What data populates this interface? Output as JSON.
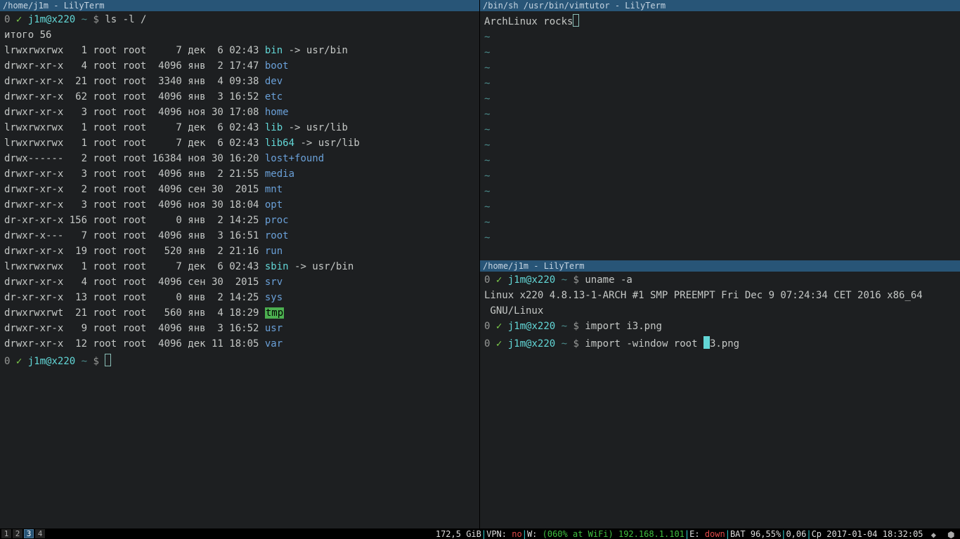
{
  "left": {
    "title": "/home/j1m - LilyTerm",
    "prompt_exit": "0",
    "prompt_check": "✓",
    "prompt_user": "j1m@x220",
    "prompt_tilde": "~",
    "prompt_dollar": "$",
    "cmd1": "ls -l /",
    "total": "итого 56",
    "rows": [
      {
        "perm": "lrwxrwxrwx",
        "n": "  1",
        "og": "root root",
        "sz": "    7",
        "date": "дек  6 02:43",
        "name": "bin",
        "link": " -> usr/bin"
      },
      {
        "perm": "drwxr-xr-x",
        "n": "  4",
        "og": "root root",
        "sz": " 4096",
        "date": "янв  2 17:47",
        "name": "boot",
        "link": ""
      },
      {
        "perm": "drwxr-xr-x",
        "n": " 21",
        "og": "root root",
        "sz": " 3340",
        "date": "янв  4 09:38",
        "name": "dev",
        "link": ""
      },
      {
        "perm": "drwxr-xr-x",
        "n": " 62",
        "og": "root root",
        "sz": " 4096",
        "date": "янв  3 16:52",
        "name": "etc",
        "link": ""
      },
      {
        "perm": "drwxr-xr-x",
        "n": "  3",
        "og": "root root",
        "sz": " 4096",
        "date": "ноя 30 17:08",
        "name": "home",
        "link": ""
      },
      {
        "perm": "lrwxrwxrwx",
        "n": "  1",
        "og": "root root",
        "sz": "    7",
        "date": "дек  6 02:43",
        "name": "lib",
        "link": " -> usr/lib"
      },
      {
        "perm": "lrwxrwxrwx",
        "n": "  1",
        "og": "root root",
        "sz": "    7",
        "date": "дек  6 02:43",
        "name": "lib64",
        "link": " -> usr/lib"
      },
      {
        "perm": "drwx------",
        "n": "  2",
        "og": "root root",
        "sz": "16384",
        "date": "ноя 30 16:20",
        "name": "lost+found",
        "link": ""
      },
      {
        "perm": "drwxr-xr-x",
        "n": "  3",
        "og": "root root",
        "sz": " 4096",
        "date": "янв  2 21:55",
        "name": "media",
        "link": ""
      },
      {
        "perm": "drwxr-xr-x",
        "n": "  2",
        "og": "root root",
        "sz": " 4096",
        "date": "сен 30  2015",
        "name": "mnt",
        "link": ""
      },
      {
        "perm": "drwxr-xr-x",
        "n": "  3",
        "og": "root root",
        "sz": " 4096",
        "date": "ноя 30 18:04",
        "name": "opt",
        "link": ""
      },
      {
        "perm": "dr-xr-xr-x",
        "n": "156",
        "og": "root root",
        "sz": "    0",
        "date": "янв  2 14:25",
        "name": "proc",
        "link": ""
      },
      {
        "perm": "drwxr-x---",
        "n": "  7",
        "og": "root root",
        "sz": " 4096",
        "date": "янв  3 16:51",
        "name": "root",
        "link": ""
      },
      {
        "perm": "drwxr-xr-x",
        "n": " 19",
        "og": "root root",
        "sz": "  520",
        "date": "янв  2 21:16",
        "name": "run",
        "link": ""
      },
      {
        "perm": "lrwxrwxrwx",
        "n": "  1",
        "og": "root root",
        "sz": "    7",
        "date": "дек  6 02:43",
        "name": "sbin",
        "link": " -> usr/bin"
      },
      {
        "perm": "drwxr-xr-x",
        "n": "  4",
        "og": "root root",
        "sz": " 4096",
        "date": "сен 30  2015",
        "name": "srv",
        "link": ""
      },
      {
        "perm": "dr-xr-xr-x",
        "n": " 13",
        "og": "root root",
        "sz": "    0",
        "date": "янв  2 14:25",
        "name": "sys",
        "link": ""
      },
      {
        "perm": "drwxrwxrwt",
        "n": " 21",
        "og": "root root",
        "sz": "  560",
        "date": "янв  4 18:29",
        "name": "tmp",
        "link": "",
        "hl": true
      },
      {
        "perm": "drwxr-xr-x",
        "n": "  9",
        "og": "root root",
        "sz": " 4096",
        "date": "янв  3 16:52",
        "name": "usr",
        "link": ""
      },
      {
        "perm": "drwxr-xr-x",
        "n": " 12",
        "og": "root root",
        "sz": " 4096",
        "date": "дек 11 18:05",
        "name": "var",
        "link": ""
      }
    ]
  },
  "rt": {
    "title": "/bin/sh /usr/bin/vimtutor - LilyTerm",
    "text": "ArchLinux rocks"
  },
  "rb": {
    "title": "/home/j1m - LilyTerm",
    "cmd1": "uname -a",
    "out1": "Linux x220 4.8.13-1-ARCH #1 SMP PREEMPT Fri Dec 9 07:24:34 CET 2016 x86_64 GNU/Linux",
    "cmd2": "import i3.png",
    "cmd3a": "import -window root ",
    "cmd3b": "i",
    "cmd3c": "3.png"
  },
  "bar": {
    "workspaces": [
      "1",
      "2",
      "3",
      "4"
    ],
    "active_ws": 2,
    "disk": "172,5 GiB",
    "vpn_label": "VPN:",
    "vpn_val": " no",
    "wifi_label": "W:",
    "wifi_val": " (060% at WiFi) 192.168.1.101",
    "eth_label": "E:",
    "eth_val": " down",
    "bat": "BAT 96,55%",
    "load": "0,06",
    "date": "Ср 2017-01-04 18:32:05"
  }
}
